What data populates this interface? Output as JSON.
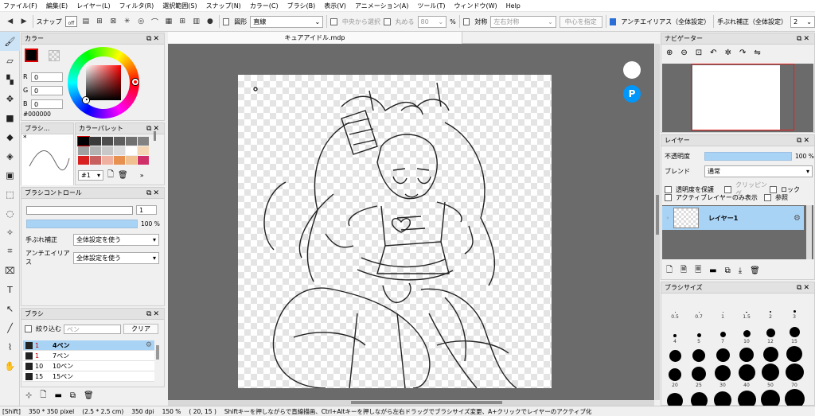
{
  "menu": [
    "ファイル(F)",
    "編集(E)",
    "レイヤー(L)",
    "フィルタ(R)",
    "選択範囲(S)",
    "スナップ(N)",
    "カラー(C)",
    "ブラシ(B)",
    "表示(V)",
    "アニメーション(A)",
    "ツール(T)",
    "ウィンドウ(W)",
    "Help"
  ],
  "toolbar": {
    "snap_label": "スナップ",
    "snap_state": "off",
    "shape_label": "図形",
    "shape_value": "直線",
    "center_select": "中央から選択",
    "round_label": "丸める",
    "round_value": "80",
    "percent": "%",
    "sym_label": "対称",
    "sym_value": "左右対称",
    "center_button": "中心を指定",
    "antialias_label": "アンチエイリアス（全体設定）",
    "stabilizer_label": "手ぶれ補正（全体設定）",
    "stabilizer_value": "2"
  },
  "color_panel": {
    "title": "カラー",
    "r_label": "R",
    "r_value": "0",
    "g_label": "G",
    "g_value": "0",
    "b_label": "B",
    "b_value": "0",
    "hex": "#000000",
    "fg": "#000000"
  },
  "brush_preview": {
    "title": "ブラシ...",
    "marker": "*"
  },
  "palette": {
    "title": "カラーパレット",
    "colors": [
      "#000000",
      "#3a3a3a",
      "#4c4c4c",
      "#5e5e5e",
      "#707070",
      "#828282",
      "#a0a0a0",
      "#b4b4b4",
      "#c8c8c8",
      "#dcdcdc",
      "#ffffff",
      "#f5d7b6",
      "#d82020",
      "#c86060",
      "#f0b0a0",
      "#e89050",
      "#f0c090",
      "#d0306a"
    ],
    "page": "#1"
  },
  "brush_control": {
    "title": "ブラシコントロール",
    "size_value": "1",
    "opacity_value": "100 %",
    "stabilizer_label": "手ぶれ補正",
    "stabilizer_value": "全体設定を使う",
    "antialias_label": "アンチエイリアス",
    "antialias_value": "全体設定を使う"
  },
  "brush_panel": {
    "title": "ブラシ",
    "filter_label": "絞り込む",
    "filter_placeholder": "ペン",
    "clear_button": "クリア",
    "items": [
      {
        "size": "1",
        "name": "4ペン",
        "color": "#c00000",
        "selected": true
      },
      {
        "size": "1",
        "name": "7ペン",
        "color": "#c00000",
        "selected": false
      },
      {
        "size": "10",
        "name": "10ペン",
        "color": "#000000",
        "selected": false
      },
      {
        "size": "15",
        "name": "15ペン",
        "color": "#000000",
        "selected": false
      }
    ]
  },
  "doc_tab": "キュアアイドル.mdp",
  "navigator": {
    "title": "ナビゲーター"
  },
  "layer_panel": {
    "title": "レイヤー",
    "opacity_label": "不透明度",
    "opacity_value": "100 %",
    "blend_label": "ブレンド",
    "blend_value": "通常",
    "protect_alpha": "透明度を保護",
    "clipping": "クリッピング",
    "lock": "ロック",
    "active_only": "アクティブレイヤーのみ表示",
    "reference": "参照",
    "layer_name": "レイヤー1"
  },
  "brush_size": {
    "title": "ブラシサイズ",
    "sizes": [
      "0.5",
      "0.7",
      "1",
      "1.5",
      "2",
      "3",
      "4",
      "5",
      "7",
      "10",
      "12",
      "15",
      "",
      "",
      "",
      "",
      "",
      "",
      "20",
      "25",
      "30",
      "40",
      "50",
      "70",
      "",
      "",
      "",
      "",
      "",
      ""
    ]
  },
  "status": {
    "mode": "[Shift]",
    "dims": "350 * 350 pixel",
    "cm": "(2.5 * 2.5 cm)",
    "dpi": "350 dpi",
    "zoom": "150 %",
    "coord": "( 20, 15 )",
    "hint": "Shiftキーを押しながらで直線描画、Ctrl+Altキーを押しながら左右ドラッグでブラシサイズ変更、A+クリックでレイヤーのアクティブ化"
  }
}
